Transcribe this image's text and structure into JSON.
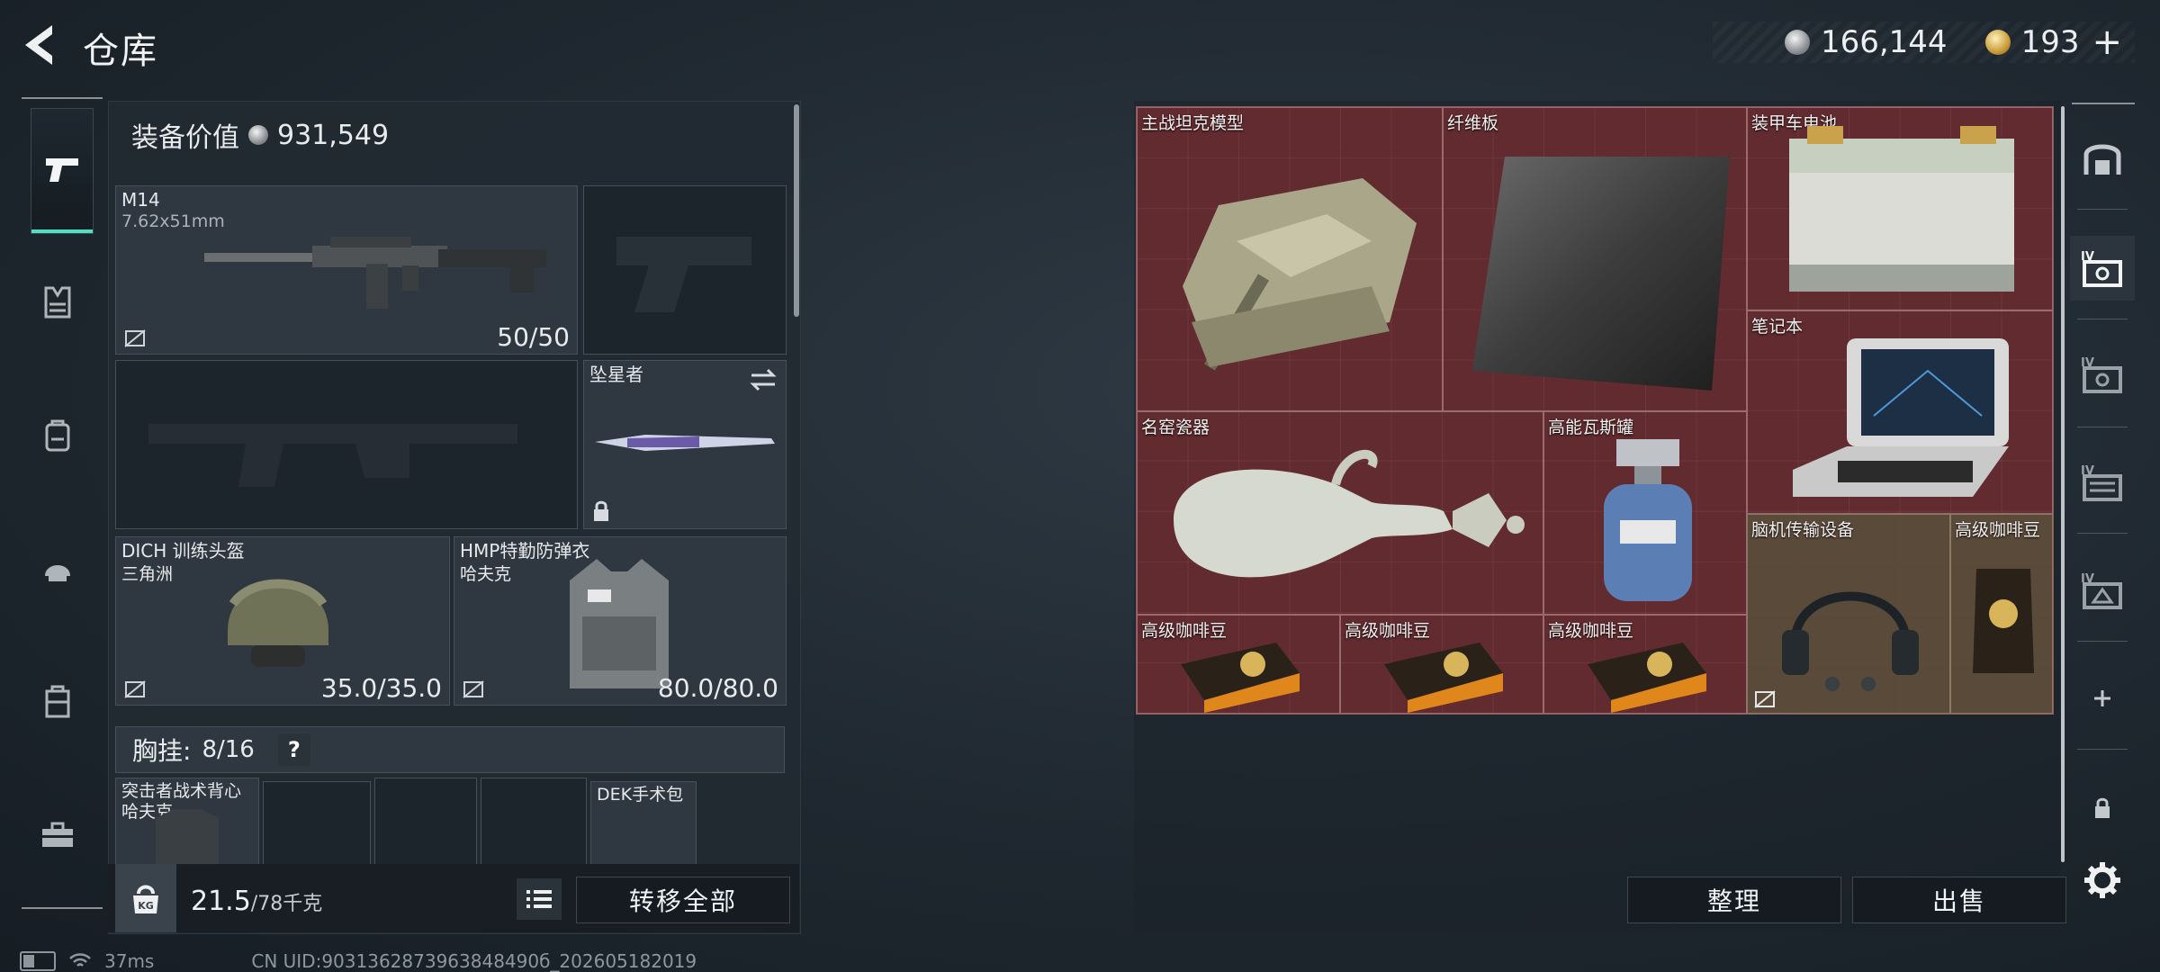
{
  "header": {
    "title": "仓库"
  },
  "currency": {
    "silver": "166,144",
    "gold": "193",
    "plus": "+"
  },
  "loadout": {
    "value_label": "装备价值",
    "value_amount": "931,549",
    "primary_weapon": {
      "name": "M14",
      "caliber": "7.62x51mm",
      "ammo": "50/50"
    },
    "melee": {
      "name": "坠星者"
    },
    "helmet": {
      "name": "DICH 训练头盔",
      "faction": "三角洲",
      "durability": "35.0/35.0"
    },
    "armor": {
      "name": "HMP特勤防弹衣",
      "faction": "哈夫克",
      "durability": "80.0/80.0"
    },
    "chest_rig": {
      "label": "胸挂:",
      "capacity": "8/16",
      "help": "?"
    },
    "backpack": {
      "name": "突击者战术背心",
      "faction": "哈夫克"
    },
    "pouch": {
      "name": "DEK手术包"
    }
  },
  "weight": {
    "current": "21.5",
    "max": "/78千克"
  },
  "buttons": {
    "transfer_all": "转移全部",
    "sort": "整理",
    "sell": "出售"
  },
  "storage_items": [
    {
      "name": "主战坦克模型"
    },
    {
      "name": "纤维板"
    },
    {
      "name": "装甲车电池"
    },
    {
      "name": "笔记本"
    },
    {
      "name": "名窑瓷器"
    },
    {
      "name": "高能瓦斯罐"
    },
    {
      "name": "脑机传输设备"
    },
    {
      "name": "高级咖啡豆"
    },
    {
      "name": "高级咖啡豆"
    },
    {
      "name": "高级咖啡豆"
    },
    {
      "name": "高级咖啡豆"
    }
  ],
  "status": {
    "ping": "37ms",
    "uid": "CN UID:9031362873963848490б_202605182019"
  },
  "icons": {
    "back": "back-arrow-icon",
    "silver": "silver-coin-icon",
    "gold": "gold-coin-icon",
    "categories": [
      "pistol-icon",
      "vest-icon",
      "backpack-icon",
      "helmet-icon",
      "case-icon",
      "toolbox-icon"
    ],
    "right_rail": [
      "safe-icon",
      "tier-iv-case-icon",
      "tier-iv-case-icon",
      "tier-iv-container-icon",
      "tier-iv-box-icon",
      "plus-icon",
      "lock-icon",
      "settings-gear-icon"
    ]
  },
  "colors": {
    "accent": "#4ee0c2",
    "grid_red": "#5f2b2f",
    "item_brown": "#5a4e3c"
  }
}
